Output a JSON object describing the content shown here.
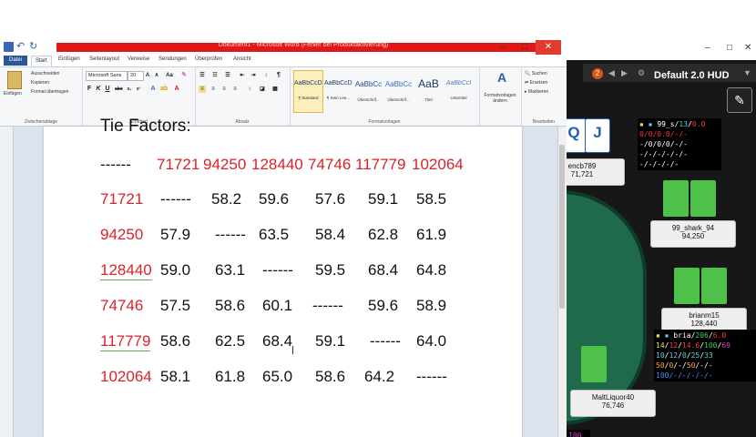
{
  "word": {
    "title": "Dokument1 - Microsoft Word (Fehler bei Produktaktivierung)",
    "tabs": [
      "Datei",
      "Start",
      "Einfügen",
      "Seitenlayout",
      "Verweise",
      "Sendungen",
      "Überprüfen",
      "Ansicht"
    ],
    "clipboard": {
      "paste": "Einfügen",
      "cut": "Ausschneiden",
      "copy": "Kopieren",
      "format_painter": "Format übertragen",
      "group": "Zwischenablage"
    },
    "font": {
      "name": "Microsoft Sans",
      "size": "20",
      "group": "Schriftart"
    },
    "paragraph_group": "Absatz",
    "styles": [
      {
        "sample": "AaBbCcDc",
        "name": "¶ Standard"
      },
      {
        "sample": "AaBbCcDc",
        "name": "¶ Kein Lee..."
      },
      {
        "sample": "AaBbCc",
        "name": "Überschrif..."
      },
      {
        "sample": "AaBbCc",
        "name": "Überschrif..."
      },
      {
        "sample": "AaB",
        "name": "Titel"
      },
      {
        "sample": "AaBbCcI",
        "name": "Untertitel"
      }
    ],
    "styles_group": "Formatvorlagen",
    "change_styles": "Formatvorlagen ändern",
    "editing": {
      "find": "Suchen",
      "replace": "Ersetzen",
      "select": "Markieren",
      "group": "Bearbeiten"
    }
  },
  "doc": {
    "heading": "Tie Factors:",
    "corner": "------",
    "columns": [
      "71721",
      "94250",
      "128440",
      "74746",
      "117779",
      "102064"
    ],
    "rows": [
      {
        "label": "71721",
        "values": [
          "------",
          "58.2",
          "59.6",
          "57.6",
          "59.1",
          "58.5"
        ]
      },
      {
        "label": "94250",
        "values": [
          "57.9",
          "------",
          "63.5",
          "58.4",
          "62.8",
          "61.9"
        ]
      },
      {
        "label": "128440",
        "values": [
          "59.0",
          "63.1",
          "------",
          "59.5",
          "68.4",
          "64.8"
        ]
      },
      {
        "label": "74746",
        "values": [
          "57.5",
          "58.6",
          "60.1",
          "------",
          "59.6",
          "58.9"
        ]
      },
      {
        "label": "117779",
        "values": [
          "58.6",
          "62.5",
          "68.4",
          "59.1",
          "------",
          "64.0"
        ]
      },
      {
        "label": "102064",
        "values": [
          "58.1",
          "61.8",
          "65.0",
          "58.6",
          "64.2",
          "------"
        ]
      }
    ]
  },
  "poker": {
    "badge": "2",
    "hud_title": "Default 2.0 HUD",
    "cards": [
      "Q",
      "J"
    ],
    "seats": [
      {
        "name": "encb789",
        "stack": "71,721"
      },
      {
        "name": "99_shark_94",
        "stack": "94,250"
      },
      {
        "name": "brianm15",
        "stack": "128,440"
      },
      {
        "name": "MaltLiquor40",
        "stack": "76,746"
      }
    ],
    "hud1": [
      [
        "99_s",
        "13",
        "0.0"
      ],
      [
        "0/0/0.0/-/-"
      ],
      [
        "-/0/0/0/-/-"
      ],
      [
        "-/-/-/-/-/-"
      ],
      [
        "-/-/-/-/-"
      ]
    ],
    "hud2": [
      [
        "bria",
        "206",
        "6.0"
      ],
      [
        "14/12/14.6/100/69"
      ],
      [
        "10/12/0/25/33"
      ],
      [
        "50/0/-/50/-/-"
      ],
      [
        "100/-/-/-/-/-"
      ]
    ],
    "bottom_tag": "100"
  }
}
